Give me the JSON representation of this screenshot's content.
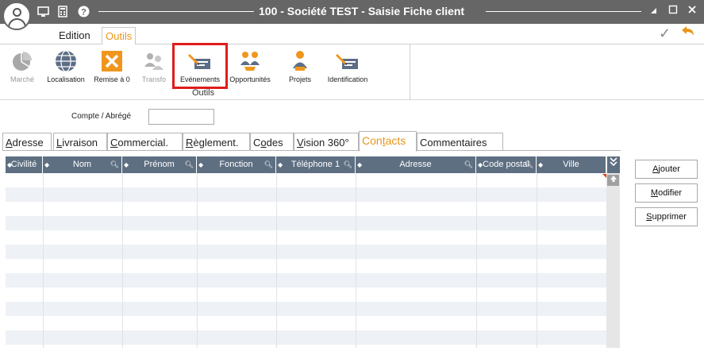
{
  "window": {
    "title": "100 - Société TEST - Saisie Fiche client"
  },
  "menu": {
    "tabs": [
      {
        "label": "Edition"
      },
      {
        "label": "Outils"
      }
    ]
  },
  "ribbon": {
    "buttons": [
      {
        "label": "Marché",
        "icon": "pie-chart-icon",
        "enabled": false
      },
      {
        "label": "Localisation",
        "icon": "globe-icon",
        "enabled": true
      },
      {
        "label": "Remise à 0",
        "icon": "reset-x-icon",
        "enabled": true
      },
      {
        "label": "Transfo",
        "icon": "transfer-people-icon",
        "enabled": false
      },
      {
        "label": "Evénements",
        "icon": "pen-card-icon",
        "enabled": true
      },
      {
        "label": "Opportunités",
        "icon": "handshake-icon",
        "enabled": true
      },
      {
        "label": "Projets",
        "icon": "project-icon",
        "enabled": true
      },
      {
        "label": "Identification",
        "icon": "pen-card-icon",
        "enabled": true
      }
    ],
    "group_label": "Outils"
  },
  "form": {
    "compte_label": "Compte / Abrégé",
    "compte_value": ""
  },
  "tabs": [
    {
      "label": "Adresse",
      "ul": "A",
      "rest": "dresse"
    },
    {
      "label": "Livraison",
      "ul": "L",
      "rest": "ivraison"
    },
    {
      "label": "Commercial.",
      "ul": "C",
      "rest": "ommercial."
    },
    {
      "label": "Règlement.",
      "ul": "R",
      "rest": "èglement."
    },
    {
      "label": "Codes",
      "pre": "C",
      "ul": "o",
      "rest": "des"
    },
    {
      "label": "Vision 360°",
      "ul": "V",
      "rest": "ision 360°"
    },
    {
      "label": "Contacts",
      "pre": "Con",
      "ul": "t",
      "rest": "acts"
    },
    {
      "label": "Commentaires",
      "ul": "",
      "rest": "Commentaires"
    }
  ],
  "active_tab": "Contacts",
  "grid": {
    "columns": [
      "Civilité",
      "Nom",
      "Prénom",
      "Fonction",
      "Téléphone 1",
      "Adresse",
      "Code postal",
      "Ville"
    ],
    "rows": []
  },
  "actions": {
    "add": {
      "ul": "A",
      "rest": "jouter"
    },
    "edit": {
      "ul": "M",
      "rest": "odifier"
    },
    "delete": {
      "ul": "S",
      "rest": "upprimer"
    }
  }
}
